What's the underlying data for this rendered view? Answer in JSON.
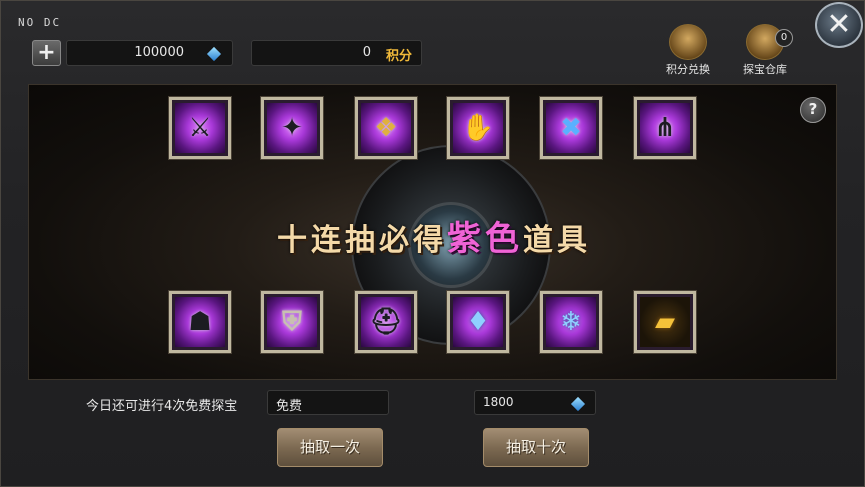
{
  "header": {
    "corner_text": "NO DC",
    "diamonds_value": "100000",
    "points_value": "0",
    "points_label": "积分"
  },
  "top_actions": [
    {
      "label": "积分兑换",
      "icon": "points-exchange-icon"
    },
    {
      "label": "探宝仓库",
      "icon": "treasure-chest-icon",
      "badge": "0"
    }
  ],
  "help_glyph": "?",
  "close_glyph": "✕",
  "headline": {
    "part1": "十连抽必得",
    "part2": "紫色",
    "part3": "道具"
  },
  "rewards_top": [
    {
      "icon": "armor-piece-icon",
      "rarity": "purple"
    },
    {
      "icon": "crossbow-orb-icon",
      "rarity": "purple"
    },
    {
      "icon": "gold-scroll-icon",
      "rarity": "purple"
    },
    {
      "icon": "dark-gauntlet-icon",
      "rarity": "purple"
    },
    {
      "icon": "blue-gem-weapon-icon",
      "rarity": "purple"
    },
    {
      "icon": "claw-blades-icon",
      "rarity": "purple"
    }
  ],
  "rewards_bottom": [
    {
      "icon": "hooded-cloak-icon",
      "rarity": "purple"
    },
    {
      "icon": "chest-armor-icon",
      "rarity": "purple"
    },
    {
      "icon": "dark-helmet-icon",
      "rarity": "purple"
    },
    {
      "icon": "blue-crystal-icon",
      "rarity": "purple"
    },
    {
      "icon": "blue-crystal-cluster-icon",
      "rarity": "purple"
    },
    {
      "icon": "gold-bars-icon",
      "rarity": "gold"
    }
  ],
  "footer": {
    "free_text": "今日还可进行4次免费探宝",
    "single_cost": "免费",
    "ten_cost": "1800",
    "single_button": "抽取一次",
    "ten_button": "抽取十次"
  }
}
